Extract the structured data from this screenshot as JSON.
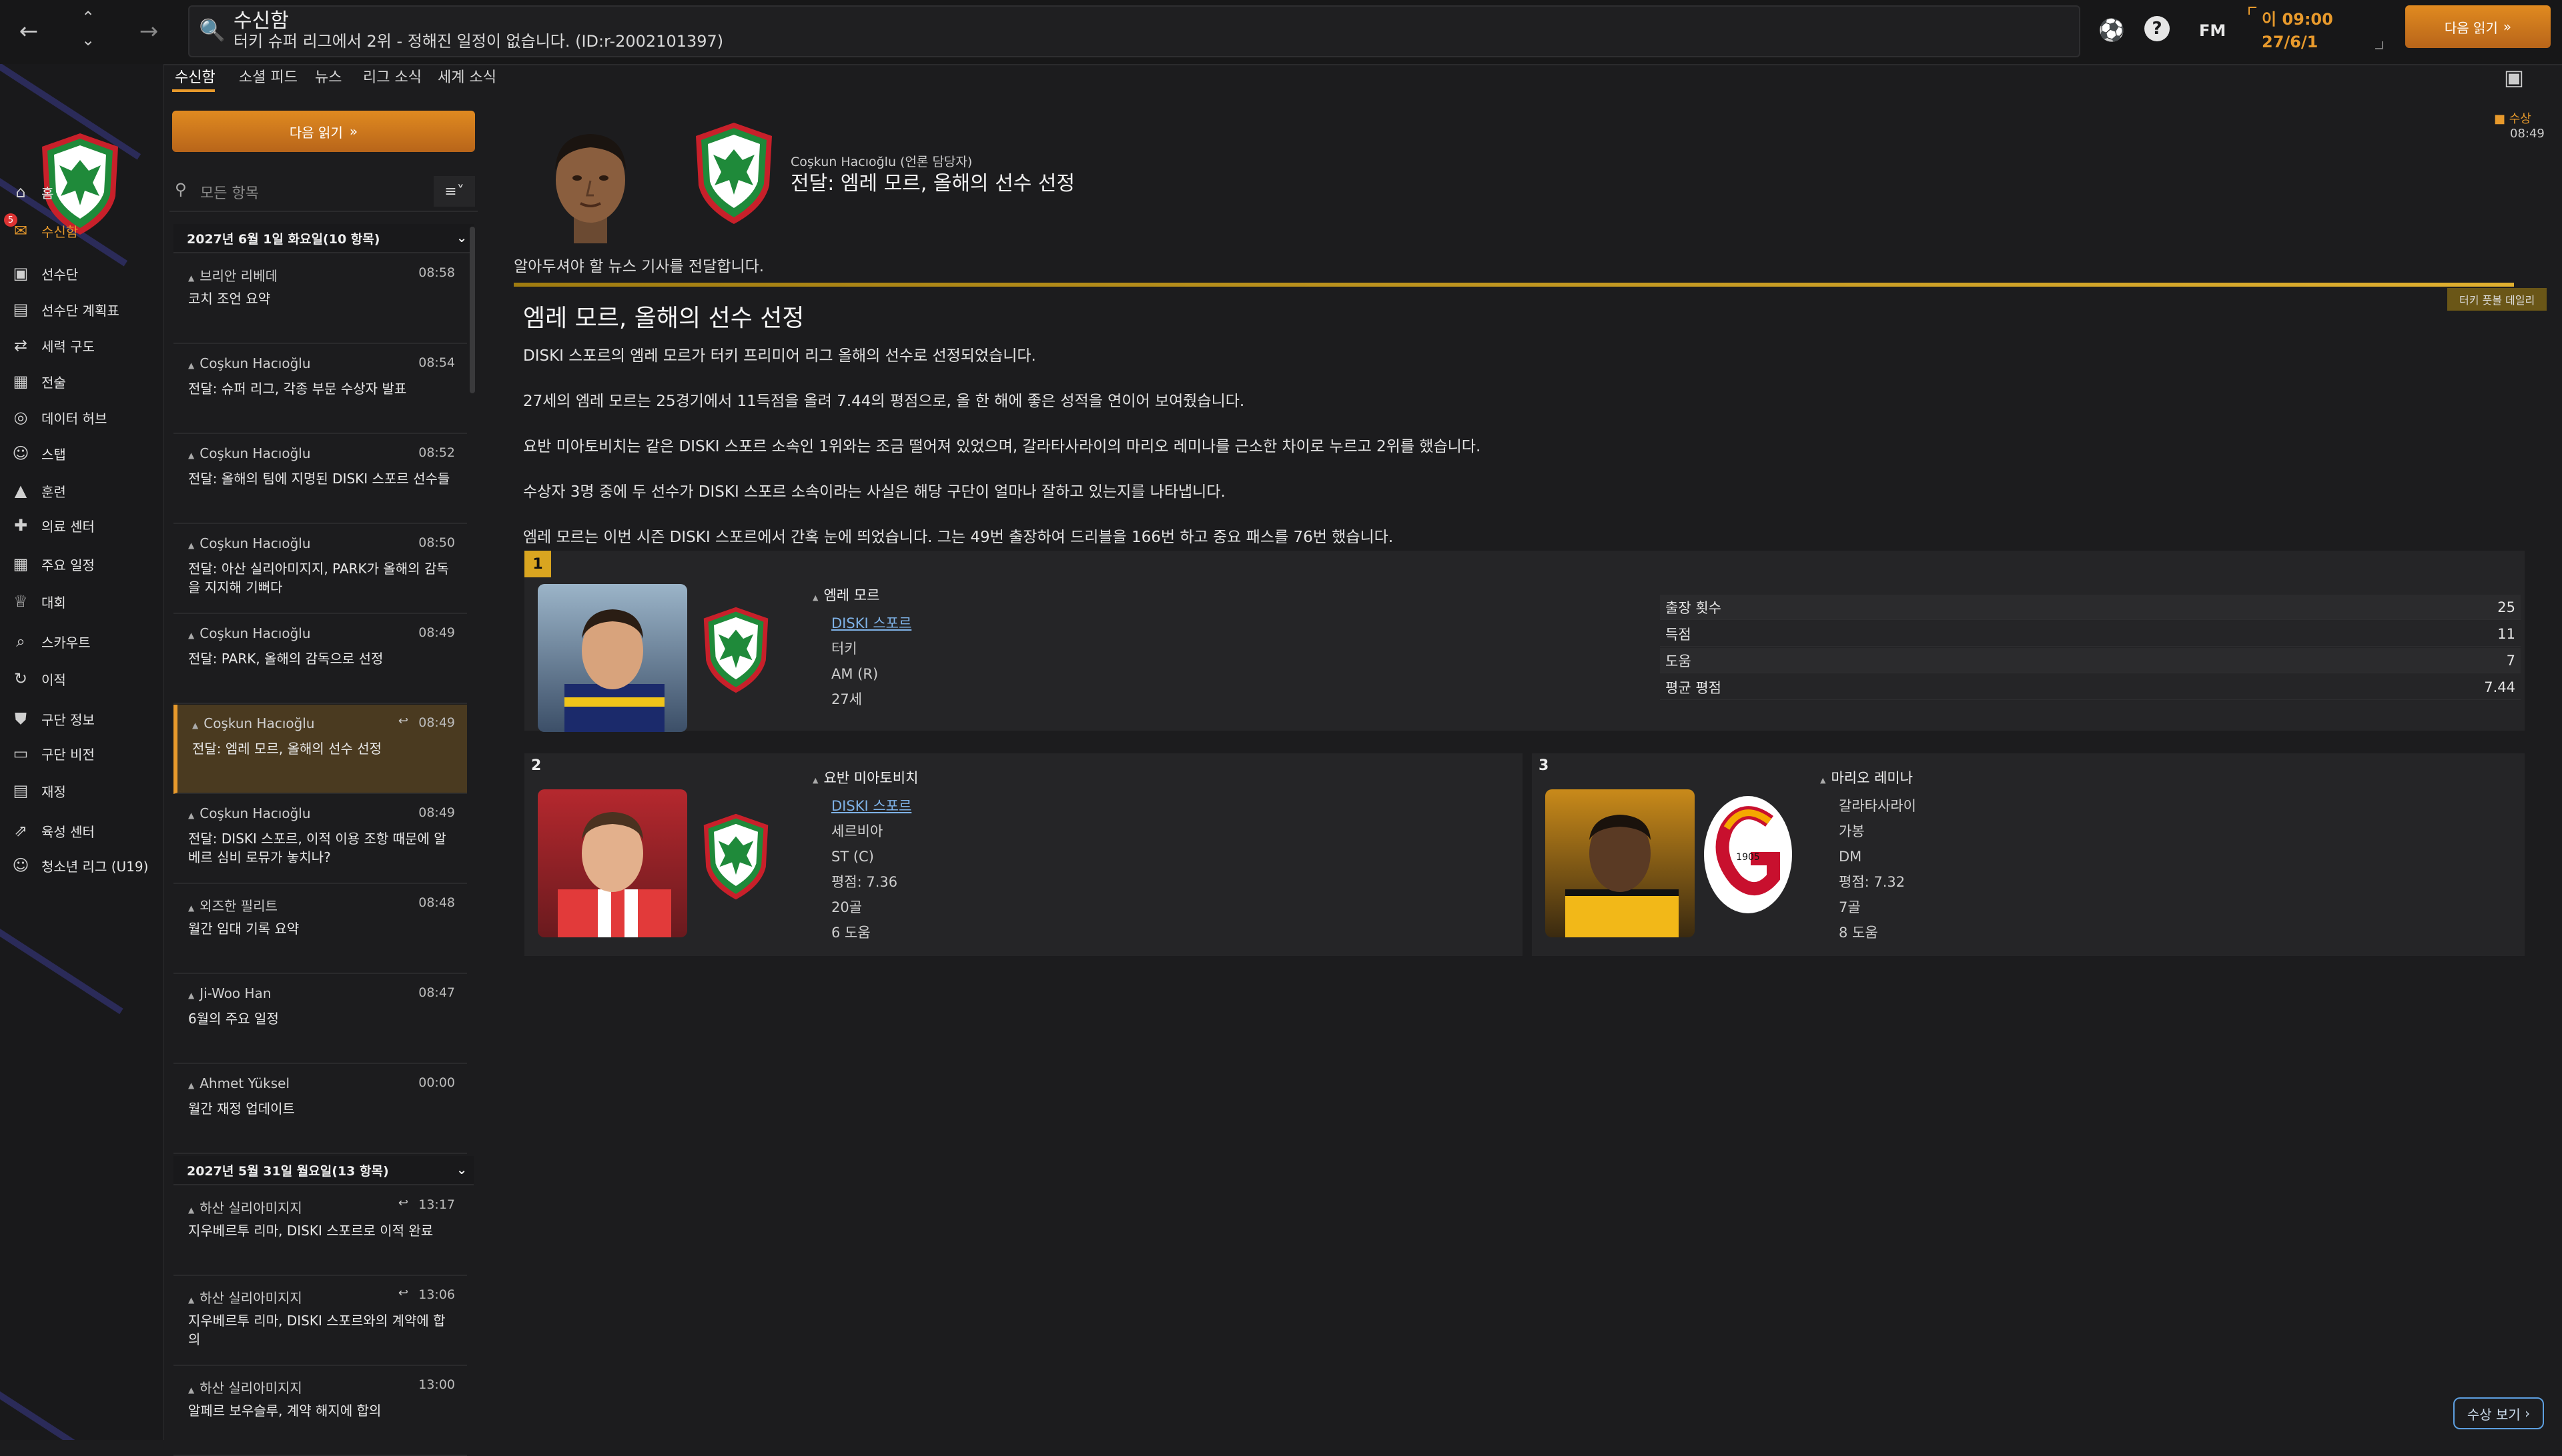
{
  "topbar": {
    "title": "수신함",
    "subtitle": "터키 슈퍼 리그에서 2위 - 정해진 일정이 없습니다. (ID:r-2002101397)",
    "fm_logo": "FM",
    "clock_time": "이 09:00",
    "clock_date": "27/6/1",
    "continue_label": "다음 읽기"
  },
  "sidebar": {
    "badge_count": "5",
    "items": [
      {
        "label": "홈",
        "icon": "home-icon"
      },
      {
        "label": "수신함",
        "icon": "inbox-icon"
      },
      {
        "label": "선수단",
        "icon": "shirt-icon"
      },
      {
        "label": "선수단 계획표",
        "icon": "clipboard-icon"
      },
      {
        "label": "세력 구도",
        "icon": "dynamics-icon"
      },
      {
        "label": "전술",
        "icon": "tactics-icon"
      },
      {
        "label": "데이터 허브",
        "icon": "data-icon"
      },
      {
        "label": "스탭",
        "icon": "staff-icon"
      },
      {
        "label": "훈련",
        "icon": "training-icon"
      },
      {
        "label": "의료 센터",
        "icon": "medical-icon"
      },
      {
        "label": "주요 일정",
        "icon": "calendar-icon"
      },
      {
        "label": "대회",
        "icon": "trophy-icon"
      },
      {
        "label": "스카우트",
        "icon": "scout-icon"
      },
      {
        "label": "이적",
        "icon": "transfer-icon"
      },
      {
        "label": "구단 정보",
        "icon": "shield-icon"
      },
      {
        "label": "구단 비전",
        "icon": "vision-icon"
      },
      {
        "label": "재정",
        "icon": "finance-icon"
      },
      {
        "label": "육성 센터",
        "icon": "development-icon"
      },
      {
        "label": "청소년 리그 (U19)",
        "icon": "youth-icon"
      }
    ]
  },
  "tabs": [
    "수신함",
    "소셜 피드",
    "뉴스",
    "리그 소식",
    "세계 소식"
  ],
  "inbox": {
    "continue_label": "다음 읽기",
    "filter_placeholder": "모든 항목",
    "groups": [
      {
        "header": "2027년 6월 1일 화요일(10 항목)",
        "messages": [
          {
            "from": "브리안 리베데",
            "time": "08:58",
            "subject": "코치 조언 요약",
            "selected": false,
            "replied": false
          },
          {
            "from": "Coşkun Hacıoğlu",
            "time": "08:54",
            "subject": "전달: 슈퍼 리그, 각종 부문 수상자 발표",
            "selected": false,
            "replied": false
          },
          {
            "from": "Coşkun Hacıoğlu",
            "time": "08:52",
            "subject": "전달: 올해의 팀에 지명된 DISKI 스포르 선수들",
            "selected": false,
            "replied": false
          },
          {
            "from": "Coşkun Hacıoğlu",
            "time": "08:50",
            "subject": "전달: 아산 실리아미지지, PARK가 올해의 감독을 지지해 기뻐다",
            "selected": false,
            "replied": false
          },
          {
            "from": "Coşkun Hacıoğlu",
            "time": "08:49",
            "subject": "전달: PARK, 올해의 감독으로 선정",
            "selected": false,
            "replied": false
          },
          {
            "from": "Coşkun Hacıoğlu",
            "time": "08:49",
            "subject": "전달: 엠레 모르, 올해의 선수 선정",
            "selected": true,
            "replied": true
          },
          {
            "from": "Coşkun Hacıoğlu",
            "time": "08:49",
            "subject": "전달: DISKI 스포르, 이적 이용 조항 때문에 알베르 심비 로뮤가 놓치나?",
            "selected": false,
            "replied": false
          },
          {
            "from": "외즈한 필리트",
            "time": "08:48",
            "subject": "월간 임대 기록 요약",
            "selected": false,
            "replied": false
          },
          {
            "from": "Ji-Woo Han",
            "time": "08:47",
            "subject": "6월의 주요 일정",
            "selected": false,
            "replied": false
          },
          {
            "from": "Ahmet Yüksel",
            "time": "00:00",
            "subject": "월간 재정 업데이트",
            "selected": false,
            "replied": false
          }
        ]
      },
      {
        "header": "2027년 5월 31일 월요일(13 항목)",
        "messages": [
          {
            "from": "하산 실리아미지지",
            "time": "13:17",
            "subject": "지우베르투 리마, DISKI 스포르로 이적 완료",
            "selected": false,
            "replied": true
          },
          {
            "from": "하산 실리아미지지",
            "time": "13:06",
            "subject": "지우베르투 리마, DISKI 스포르와의 계약에 합의",
            "selected": false,
            "replied": true
          },
          {
            "from": "하산 실리아미지지",
            "time": "13:00",
            "subject": "알페르 보우슬루, 계약 해지에 합의",
            "selected": false,
            "replied": false
          }
        ]
      }
    ]
  },
  "mail": {
    "tag": "수상",
    "time": "08:49",
    "sender": "Coşkun Hacıoğlu (언론 담당자)",
    "subject": "전달: 엠레 모르, 올해의 선수 선정",
    "intro": "알아두셔야 할 뉴스 기사를 전달합니다.",
    "source": "터키 풋볼 데일리",
    "headline": "엠레 모르, 올해의 선수 선정",
    "paragraphs": [
      "DISKI 스포르의 엠레 모르가 터키 프리미어 리그 올해의 선수로 선정되었습니다.",
      "27세의 엠레 모르는 25경기에서 11득점을 올려 7.44의 평점으로, 올 한 해에 좋은 성적을 연이어 보여줬습니다.",
      "요반 미아토비치는 같은 DISKI 스포르 소속인 1위와는 조금 떨어져 있었으며, 갈라타사라이의 마리오 레미나를 근소한 차이로 누르고 2위를 했습니다.",
      "수상자 3명 중에 두 선수가 DISKI 스포르 소속이라는 사실은 해당 구단이 얼마나 잘하고 있는지를 나타냅니다.",
      "엠레 모르는 이번 시즌 DISKI 스포르에서 간혹 눈에 띄었습니다. 그는 49번 출장하여 드리블을 166번 하고 중요 패스를 76번 했습니다."
    ],
    "winners": [
      {
        "rank": "1",
        "name": "엠레 모르",
        "club": "DISKI 스포르",
        "nation": "터키",
        "position": "AM (R)",
        "age": "27세",
        "stats": [
          {
            "label": "출장 횟수",
            "value": "25"
          },
          {
            "label": "득점",
            "value": "11"
          },
          {
            "label": "도움",
            "value": "7"
          },
          {
            "label": "평균 평점",
            "value": "7.44"
          }
        ]
      },
      {
        "rank": "2",
        "name": "요반 미아토비치",
        "club": "DISKI 스포르",
        "nation": "세르비아",
        "position": "ST (C)",
        "rating": "평점: 7.36",
        "goals": "20골",
        "assists": "6 도움"
      },
      {
        "rank": "3",
        "name": "마리오 레미나",
        "club": "갈라타사라이",
        "nation": "가봉",
        "position": "DM",
        "rating": "평점: 7.32",
        "goals": "7골",
        "assists": "8 도움"
      }
    ],
    "awards_button": "수상 보기"
  },
  "colors": {
    "accent": "#e89a2c",
    "background": "#1c1c1e",
    "link": "#7fb3e8",
    "crest_green": "#1f8a3a",
    "crest_red": "#c8202a"
  }
}
